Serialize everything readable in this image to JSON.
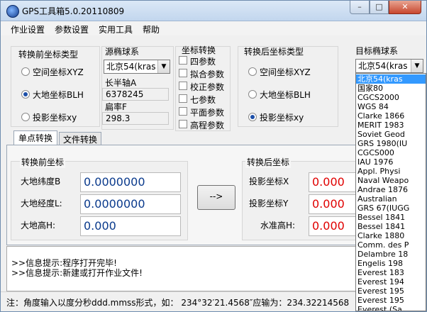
{
  "window": {
    "title": "GPS工具箱5.0.20110809",
    "min_glyph": "–",
    "max_glyph": "□",
    "close_glyph": "✕"
  },
  "menu": [
    "作业设置",
    "参数设置",
    "实用工具",
    "帮助"
  ],
  "src_type": {
    "title": "转换前坐标类型",
    "options": [
      "空间坐标XYZ",
      "大地坐标BLH",
      "投影坐标xy"
    ],
    "selected": 1
  },
  "src_ellipsoid": {
    "title": "源椭球系",
    "selected": "北京54(kras",
    "semi_major_label": "长半轴A",
    "semi_major_value": "6378245",
    "flattening_label": "扁率F",
    "flattening_value": "298.3"
  },
  "transform": {
    "title": "坐标转换",
    "options": [
      "四参数",
      "拟合参数",
      "校正参数",
      "七参数",
      "平面参数",
      "高程参数"
    ]
  },
  "dst_type": {
    "title": "转换后坐标类型",
    "options": [
      "空间坐标XYZ",
      "大地坐标BLH",
      "投影坐标xy"
    ],
    "selected": 2
  },
  "dst_ellipsoid": {
    "title": "目标椭球系",
    "selected": "北京54(kras",
    "list": [
      "北京54(kras",
      "国家80",
      "CGCS2000",
      "WGS 84",
      "Clarke 1866",
      "MERIT 1983",
      "Soviet Geod",
      "GRS 1980(IU",
      "CGCS000",
      "IAU 1976",
      "Appl. Physi",
      "Naval Weapo",
      "Andrae 1876",
      "Australian",
      "GRS 67(IUGG",
      "Bessel 1841",
      "Bessel 1841",
      "Clarke 1880",
      "Comm. des P",
      "Delambre 18",
      "Engelis 198",
      "Everest 183",
      "Everest 194",
      "Everest 195",
      "Everest 195",
      "Everest (Sa"
    ]
  },
  "tabs": [
    "单点转换",
    "文件转换"
  ],
  "before": {
    "title": "转换前坐标",
    "lat_label": "大地纬度B",
    "lat_value": "0.0000000",
    "lon_label": "大地经度L:",
    "lon_value": "0.0000000",
    "h_label": "大地高H:",
    "h_value": "0.000"
  },
  "convert_label": "-->",
  "after": {
    "title": "转换后坐标",
    "x_label": "投影坐标X",
    "x_value": "0.000",
    "y_label": "投影坐标Y",
    "y_value": "0.000",
    "h_label": "水准高H:",
    "h_value": "0.000"
  },
  "messages": [
    ">>信息提示:程序打开完毕!",
    ">>信息提示:新建或打开作业文件!"
  ],
  "status": "注：角度输入以度分秒ddd.mmss形式，如：  234°32′21.4568″应输为：234.32214568",
  "colors": {
    "output_red": "#e00000",
    "input_blue": "#0a3a8c",
    "selection": "#3399ff"
  }
}
